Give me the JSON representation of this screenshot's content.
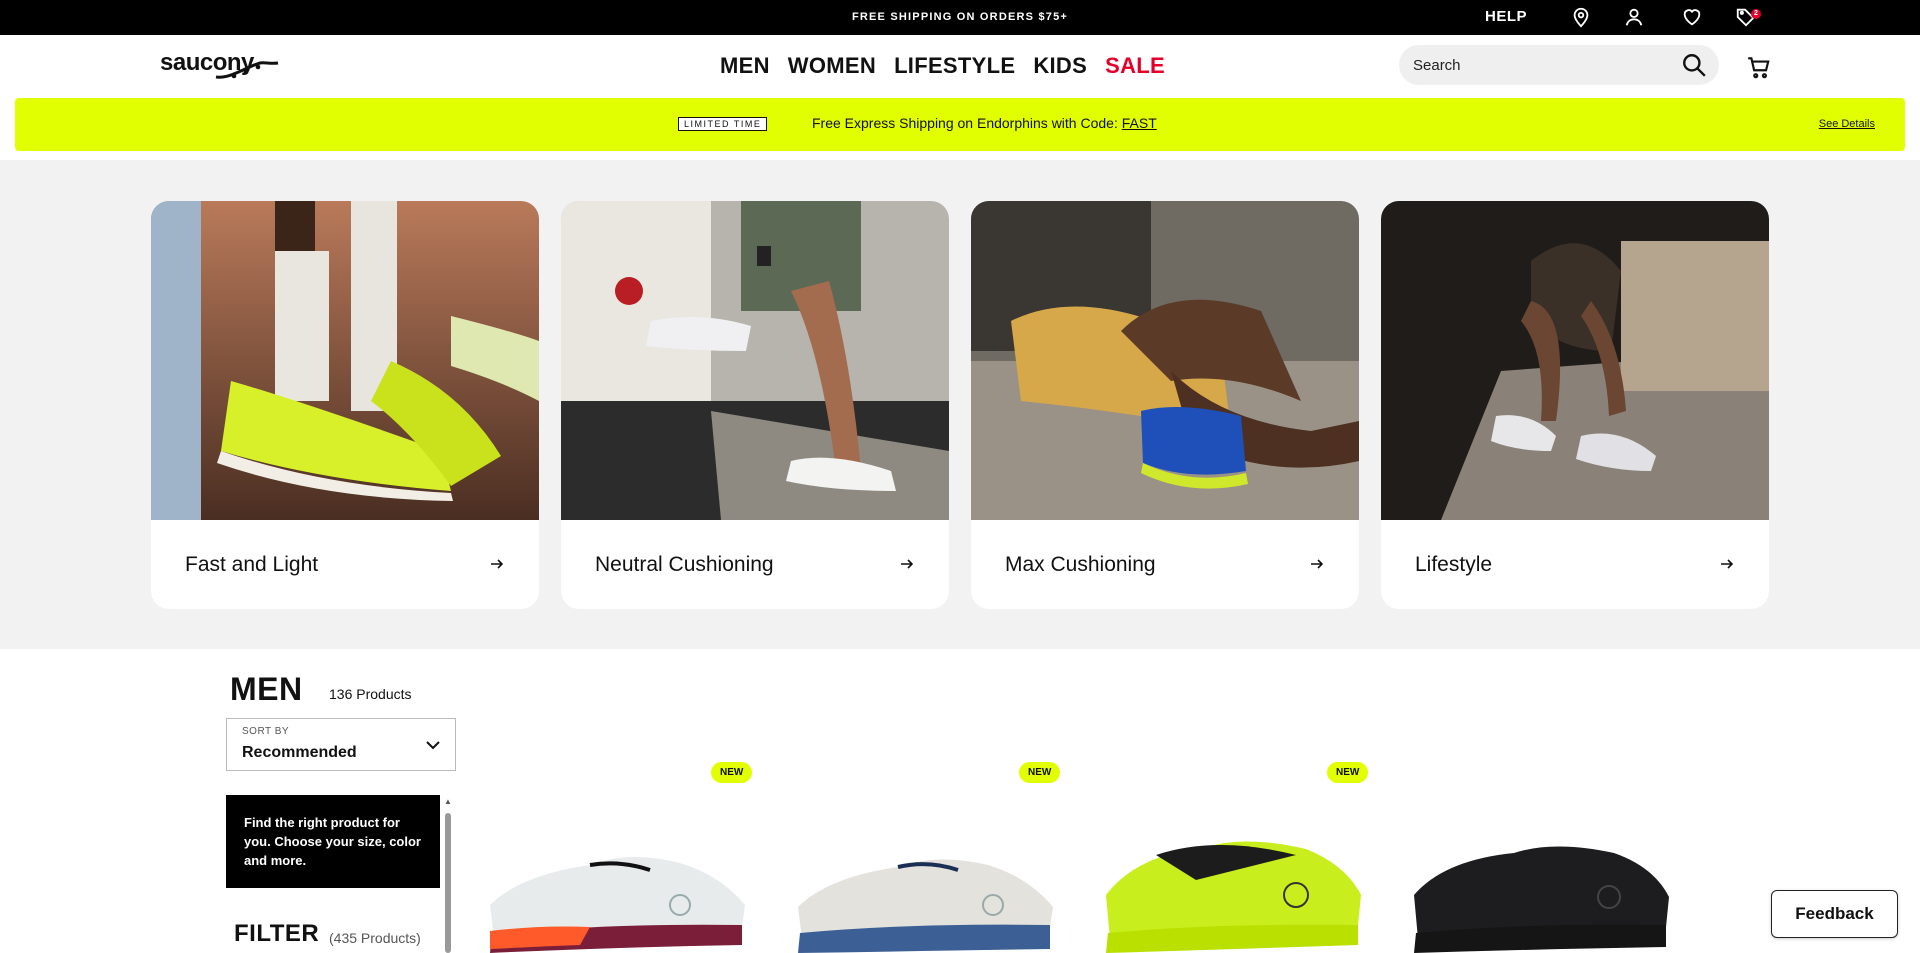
{
  "topbar": {
    "shipping_text": "FREE SHIPPING ON ORDERS $75+",
    "help_label": "HELP",
    "icons": [
      "location-icon",
      "account-icon",
      "wishlist-icon",
      "saved-tag-icon"
    ],
    "saved_badge": "2"
  },
  "header": {
    "logo_text": "saucony",
    "nav": [
      {
        "label": "MEN"
      },
      {
        "label": "WOMEN"
      },
      {
        "label": "LIFESTYLE"
      },
      {
        "label": "KIDS"
      },
      {
        "label": "SALE"
      }
    ],
    "search_placeholder": "Search",
    "sale_color": "#e4002b"
  },
  "promo": {
    "tag": "LIMITED TIME",
    "message": "Free Express Shipping on Endorphins with Code: ",
    "code": "FAST",
    "details_link": "See Details",
    "accent": "#e1ff00"
  },
  "categories": [
    {
      "label": "Fast and Light"
    },
    {
      "label": "Neutral Cushioning"
    },
    {
      "label": "Max Cushioning"
    },
    {
      "label": "Lifestyle"
    }
  ],
  "listing": {
    "title": "MEN",
    "count": "136 Products",
    "sort_label": "SORT BY",
    "sort_value": "Recommended",
    "find_text": "Find the right product for you. Choose your size, color and more.",
    "filter_title": "FILTER",
    "filter_count": "(435 Products)"
  },
  "products": [
    {
      "badge": "NEW"
    },
    {
      "badge": "NEW"
    },
    {
      "badge": "NEW"
    },
    {
      "badge": ""
    }
  ],
  "feedback_label": "Feedback"
}
